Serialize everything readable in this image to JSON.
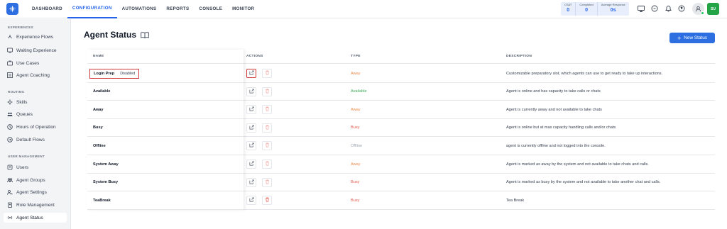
{
  "nav": {
    "items": [
      {
        "label": "DASHBOARD",
        "active": false
      },
      {
        "label": "CONFIGURATION",
        "active": true
      },
      {
        "label": "AUTOMATIONS",
        "active": false
      },
      {
        "label": "REPORTS",
        "active": false
      },
      {
        "label": "CONSOLE",
        "active": false
      },
      {
        "label": "MONITOR",
        "active": false
      }
    ]
  },
  "stats": [
    {
      "label": "CSAT",
      "value": "0"
    },
    {
      "label": "Completed",
      "value": "0"
    },
    {
      "label": "Average Response",
      "value": "0s"
    }
  ],
  "user": {
    "initials": "SU"
  },
  "sidebar": {
    "sections": [
      {
        "title": "EXPERIENCES",
        "items": [
          {
            "label": "Experience Flows",
            "icon": "flow-icon"
          },
          {
            "label": "Waiting Experience",
            "icon": "monitor-icon"
          },
          {
            "label": "Use Cases",
            "icon": "cases-icon"
          },
          {
            "label": "Agent Coaching",
            "icon": "coaching-icon"
          }
        ]
      },
      {
        "title": "ROUTING",
        "items": [
          {
            "label": "Skills",
            "icon": "skills-icon"
          },
          {
            "label": "Queues",
            "icon": "queues-icon"
          },
          {
            "label": "Hours of Operation",
            "icon": "clock-icon"
          },
          {
            "label": "Default Flows",
            "icon": "default-flow-icon"
          }
        ]
      },
      {
        "title": "USER MANAGEMENT",
        "items": [
          {
            "label": "Users",
            "icon": "users-icon"
          },
          {
            "label": "Agent Groups",
            "icon": "groups-icon"
          },
          {
            "label": "Agent Settings",
            "icon": "settings-icon"
          },
          {
            "label": "Role Management",
            "icon": "role-icon"
          },
          {
            "label": "Agent Status",
            "icon": "status-icon"
          }
        ]
      }
    ]
  },
  "page": {
    "title": "Agent Status",
    "new_button": "New Status"
  },
  "table": {
    "headers": {
      "name": "NAME",
      "actions": "ACTIONS",
      "type": "TYPE",
      "description": "DESCRIPTION"
    },
    "rows": [
      {
        "name": "Login Prep",
        "tag": "Disabled",
        "type": "Away",
        "description": "Customizable preparatory slot, which agents can use to get ready to take up interactions."
      },
      {
        "name": "Available",
        "tag": "",
        "type": "Available",
        "description": "Agent is online and has capacity to take calls or chats"
      },
      {
        "name": "Away",
        "tag": "",
        "type": "Away",
        "description": "Agent is currently away and not available to take chats"
      },
      {
        "name": "Busy",
        "tag": "",
        "type": "Busy",
        "description": "Agent is online but at max capacity handling calls and/or chats"
      },
      {
        "name": "Offline",
        "tag": "",
        "type": "Offline",
        "description": "agent is currently offline and not logged into the console."
      },
      {
        "name": "System Away",
        "tag": "",
        "type": "Away",
        "description": "Agent is marked as away by the system and not available to take chats and calls."
      },
      {
        "name": "System Busy",
        "tag": "",
        "type": "Busy",
        "description": "Agent is marked as busy by the system and not available to take another chat and calls."
      },
      {
        "name": "TeaBreak",
        "tag": "",
        "type": "Busy",
        "description": "Tea Break"
      }
    ]
  },
  "colors": {
    "accent": "#2d6fe0",
    "away": "#ec8c4d",
    "busy": "#e45a4f",
    "available": "#3aa856",
    "offline": "#9ca3af",
    "highlight": "#d33b3b"
  }
}
